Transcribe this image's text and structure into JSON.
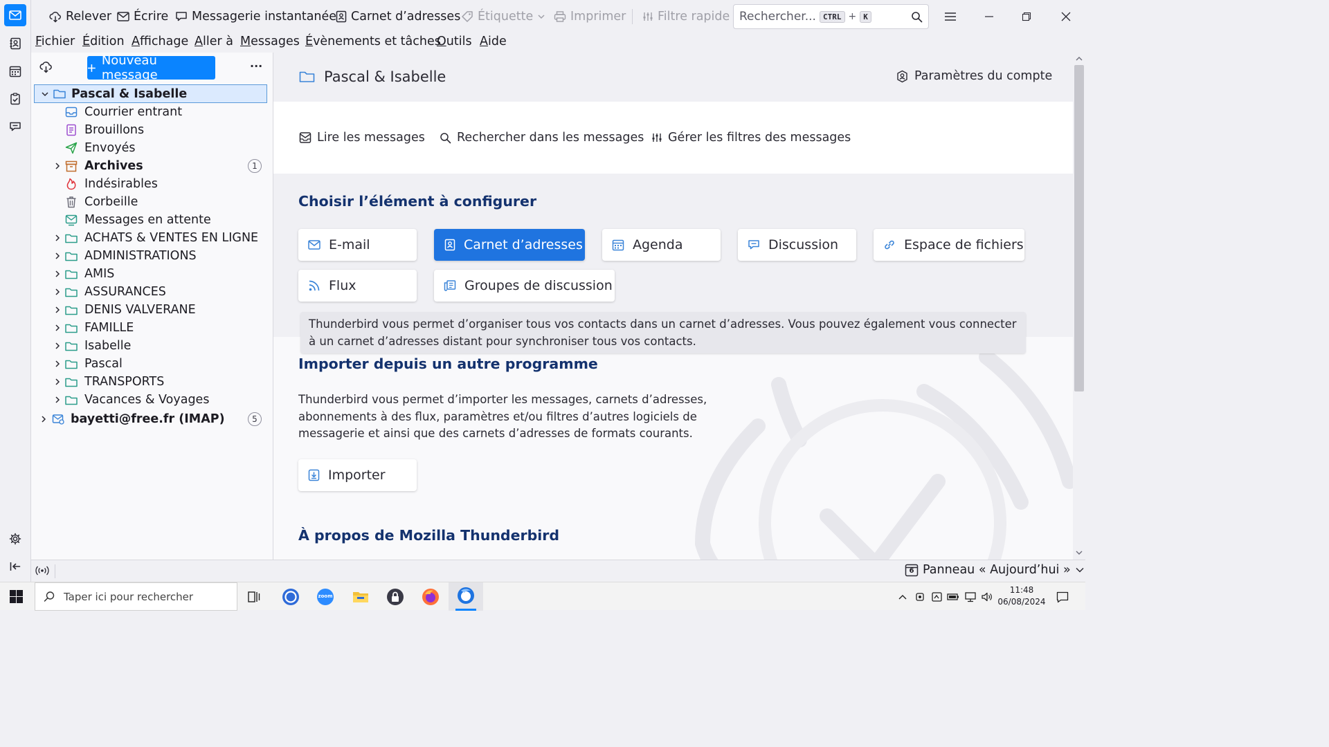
{
  "toolbar": {
    "get_messages": "Relever",
    "write": "Écrire",
    "chat": "Messagerie instantanée",
    "address_book": "Carnet d’adresses",
    "tag": "Étiquette",
    "print": "Imprimer",
    "quick_filter": "Filtre rapide",
    "search_placeholder": "Rechercher...",
    "shortcut_mod": "CTRL",
    "shortcut_plus": "+",
    "shortcut_key": "K"
  },
  "menubar": {
    "items": [
      {
        "first": "F",
        "rest": "ichier"
      },
      {
        "first": "É",
        "rest": "dition"
      },
      {
        "first": "A",
        "rest": "ffichage"
      },
      {
        "first": "A",
        "rest": "ller à"
      },
      {
        "first": "M",
        "rest": "essages"
      },
      {
        "first": "É",
        "rest": "vènements et tâches"
      },
      {
        "first": "O",
        "rest": "utils"
      },
      {
        "first": "A",
        "rest": "ide"
      }
    ]
  },
  "folder_pane": {
    "new_message": "Nouveau message",
    "more": "···",
    "account": "Pascal & Isabelle",
    "folders": [
      {
        "label": "Courrier entrant"
      },
      {
        "label": "Brouillons"
      },
      {
        "label": "Envoyés"
      },
      {
        "label": "Archives",
        "badge": "1"
      },
      {
        "label": "Indésirables"
      },
      {
        "label": "Corbeille"
      },
      {
        "label": "Messages en attente"
      },
      {
        "label": "ACHATS & VENTES EN LIGNE"
      },
      {
        "label": "ADMINISTRATIONS"
      },
      {
        "label": "AMIS"
      },
      {
        "label": "ASSURANCES"
      },
      {
        "label": "DENIS VALVERANE"
      },
      {
        "label": "FAMILLE"
      },
      {
        "label": "Isabelle"
      },
      {
        "label": "Pascal"
      },
      {
        "label": "TRANSPORTS"
      },
      {
        "label": "Vacances & Voyages"
      }
    ],
    "imap_account": {
      "label": "bayetti@free.fr (IMAP)",
      "badge": "5"
    }
  },
  "content": {
    "account_title": "Pascal & Isabelle",
    "account_settings": "Paramètres du compte",
    "actions": {
      "read": "Lire les messages",
      "search": "Rechercher dans les messages",
      "filters": "Gérer les filtres des messages"
    },
    "configure_heading": "Choisir l’élément à configurer",
    "cards": {
      "email": "E-mail",
      "address_book": "Carnet d’adresses",
      "calendar": "Agenda",
      "chat": "Discussion",
      "filelink": "Espace de fichiers",
      "feeds": "Flux",
      "newsgroups": "Groupes de discussion"
    },
    "card_description": "Thunderbird vous permet d’organiser tous vos contacts dans un carnet d’adresses. Vous pouvez également vous connecter à un carnet d’adresses distant pour synchroniser tous vos contacts.",
    "import_heading": "Importer depuis un autre programme",
    "import_text": "Thunderbird vous permet d’importer les messages, carnets d’adresses, abonnements à des flux, paramètres et/ou filtres d’autres logiciels de messagerie et ainsi que des carnets d’adresses de formats courants.",
    "import_button": "Importer",
    "about_heading": "À propos de Mozilla Thunderbird"
  },
  "statusbar": {
    "today_pane": "Panneau « Aujourd’hui »",
    "calendar_day": "6"
  },
  "taskbar": {
    "search_placeholder": "Taper ici pour rechercher",
    "zoom_label": "zoom",
    "time": "11:48",
    "date": "06/08/2024"
  },
  "colors": {
    "accent": "#0a84ff",
    "selected_card": "#1f74e0",
    "heading": "#14326e"
  }
}
